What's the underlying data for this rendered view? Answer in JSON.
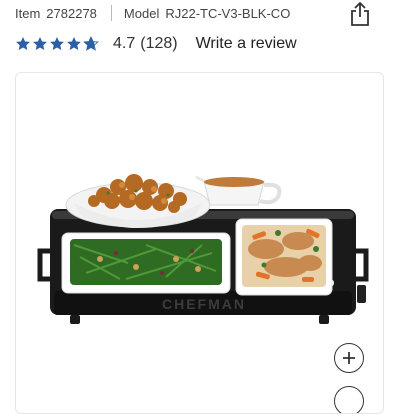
{
  "product": {
    "item_label": "Item",
    "item_number": "2782278",
    "model_label": "Model",
    "model_number": "RJ22-TC-V3-BLK-CO"
  },
  "rating": {
    "stars": 4.7,
    "value_text": "4.7",
    "count_text": "(128)",
    "write_review_label": "Write a review",
    "star_color": "#2a5fa8"
  },
  "image": {
    "brand_text": "CHEFMAN",
    "zoom_icon": "plus-icon"
  },
  "share": {
    "icon": "share-icon"
  }
}
